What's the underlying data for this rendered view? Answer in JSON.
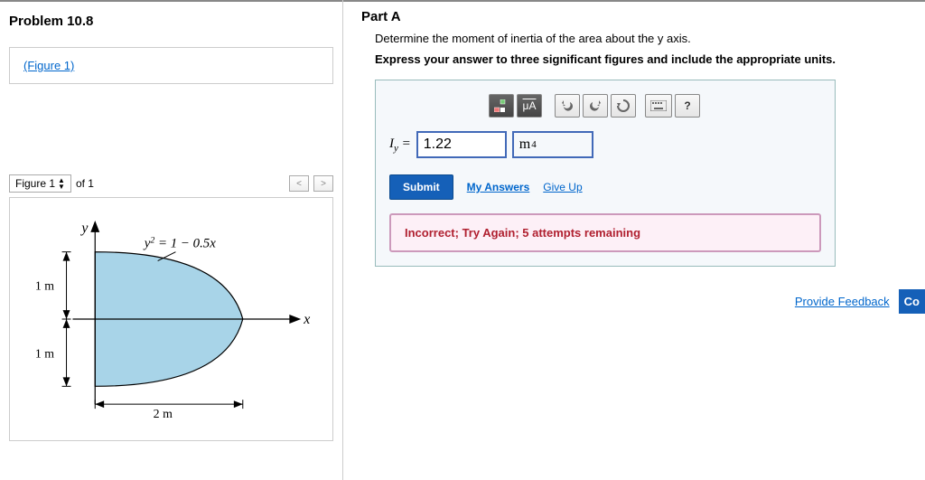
{
  "problem": {
    "title": "Problem 10.8",
    "figure_link": "(Figure 1)"
  },
  "figure_nav": {
    "label": "Figure 1",
    "of_text": "of 1"
  },
  "figure": {
    "y_axis": "y",
    "x_axis": "x",
    "equation": "y² = 1 − 0.5x",
    "dim_1m_top": "1 m",
    "dim_1m_bot": "1 m",
    "dim_2m": "2 m"
  },
  "partA": {
    "title": "Part A",
    "prompt": "Determine the moment of inertia of the area about the y axis.",
    "instruction": "Express your answer to three significant figures and include the appropriate units."
  },
  "toolbar": {
    "units_mu": "μA",
    "help": "?"
  },
  "answer": {
    "label_html": "Iᵧ =",
    "value": "1.22",
    "unit_base": "m",
    "unit_exp": "4"
  },
  "actions": {
    "submit": "Submit",
    "my_answers": "My Answers",
    "give_up": "Give Up"
  },
  "feedback": {
    "message": "Incorrect; Try Again; 5 attempts remaining"
  },
  "footer": {
    "provide_feedback": "Provide Feedback",
    "continue_partial": "Co"
  }
}
